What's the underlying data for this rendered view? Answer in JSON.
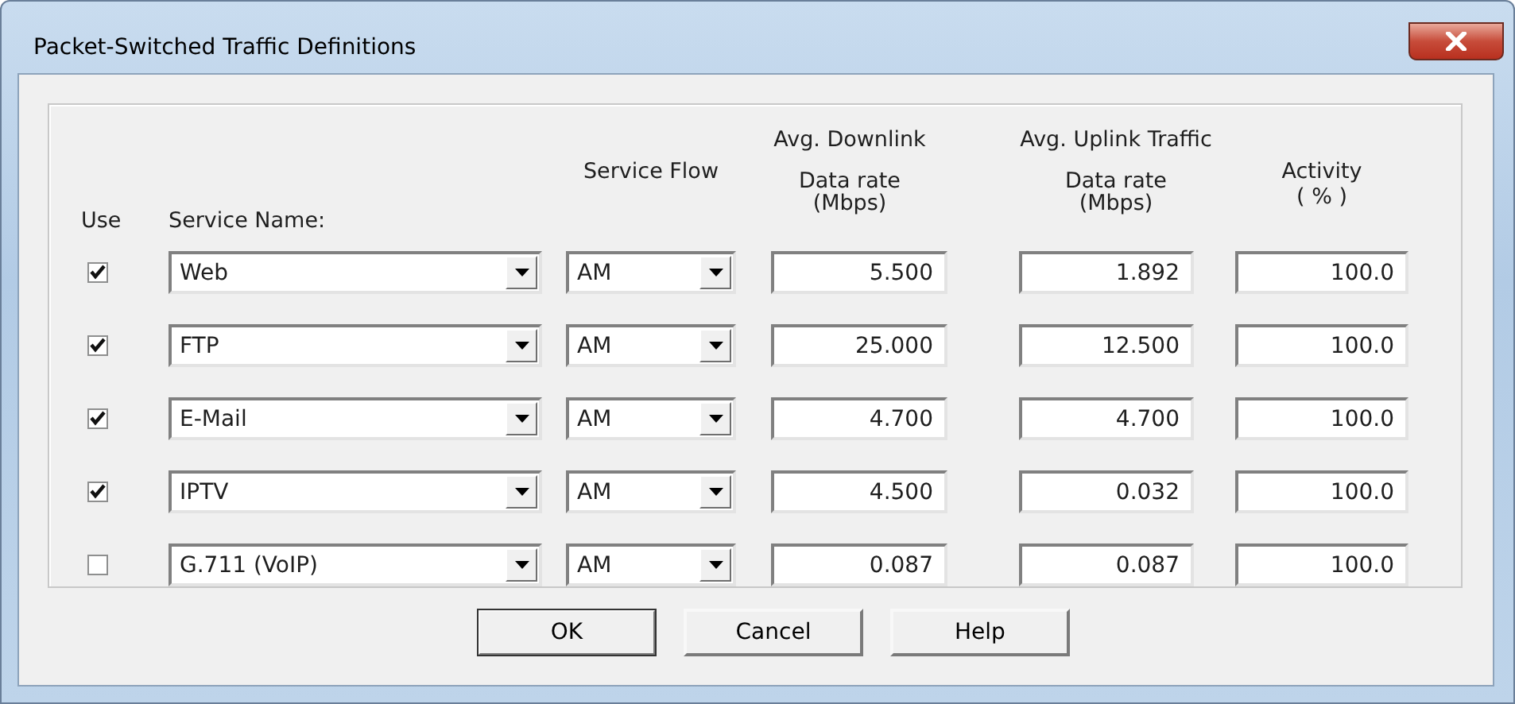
{
  "window": {
    "title": "Packet-Switched Traffic Definitions"
  },
  "columns": {
    "use": "Use",
    "service_name": "Service Name:",
    "service_flow": "Service Flow",
    "downlink_group": "Avg. Downlink",
    "downlink_rate": "Data rate",
    "downlink_unit": "(Mbps)",
    "uplink_group": "Avg. Uplink Traffic",
    "uplink_rate": "Data rate",
    "uplink_unit": "(Mbps)",
    "activity": "Activity",
    "activity_unit": "( % )"
  },
  "rows": [
    {
      "use": true,
      "service": "Web",
      "flow": "AM",
      "downlink": "5.500",
      "uplink": "1.892",
      "activity": "100.0"
    },
    {
      "use": true,
      "service": "FTP",
      "flow": "AM",
      "downlink": "25.000",
      "uplink": "12.500",
      "activity": "100.0"
    },
    {
      "use": true,
      "service": "E-Mail",
      "flow": "AM",
      "downlink": "4.700",
      "uplink": "4.700",
      "activity": "100.0"
    },
    {
      "use": true,
      "service": "IPTV",
      "flow": "AM",
      "downlink": "4.500",
      "uplink": "0.032",
      "activity": "100.0"
    },
    {
      "use": false,
      "service": "G.711 (VoIP)",
      "flow": "AM",
      "downlink": "0.087",
      "uplink": "0.087",
      "activity": "100.0"
    }
  ],
  "buttons": [
    {
      "label": "OK",
      "default": true
    },
    {
      "label": "Cancel",
      "default": false
    },
    {
      "label": "Help",
      "default": false
    }
  ]
}
